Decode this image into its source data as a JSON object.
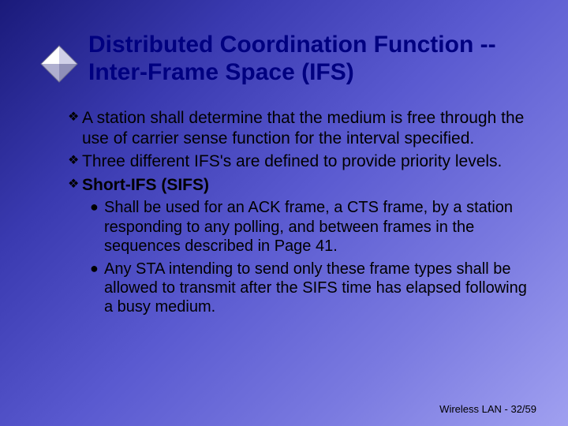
{
  "title": "Distributed Coordination Function -- Inter-Frame Space (IFS)",
  "bullets": [
    {
      "text": "A station shall determine that the medium is free through the use of carrier sense function for the interval specified.",
      "bold": false
    },
    {
      "text": "Three different IFS's are defined to provide priority levels.",
      "bold": false
    },
    {
      "text": "Short-IFS (SIFS)",
      "bold": true
    }
  ],
  "subbullets": [
    {
      "text": "Shall be used for an ACK frame, a CTS frame, by a station responding to any polling, and between frames in the sequences described in Page 41."
    },
    {
      "text": "Any STA intending to send only these frame types shall be allowed to transmit after the SIFS time has elapsed following a busy medium."
    }
  ],
  "footer": "Wireless LAN - 32/59",
  "markers": {
    "l1": "❖",
    "l2": "●"
  }
}
